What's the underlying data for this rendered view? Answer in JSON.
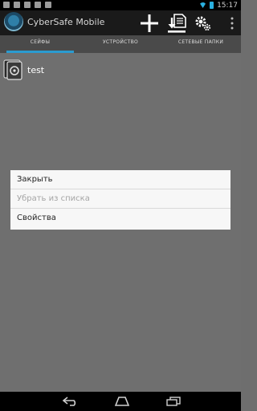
{
  "status_bar": {
    "time": "15:17"
  },
  "action_bar": {
    "title": "CyberSafe Mobile"
  },
  "tabs": [
    {
      "label": "СЕЙФЫ",
      "active": true
    },
    {
      "label": "УСТРОЙСТВО",
      "active": false
    },
    {
      "label": "СЕТЕВЫЕ ПАПКИ",
      "active": false
    }
  ],
  "list": {
    "items": [
      {
        "label": "test"
      }
    ]
  },
  "context_menu": {
    "items": [
      {
        "label": "Закрыть",
        "enabled": true
      },
      {
        "label": "Убрать из списка",
        "enabled": false
      },
      {
        "label": "Свойства",
        "enabled": true
      }
    ]
  },
  "colors": {
    "accent": "#2a9bd0",
    "dialog_bg": "#f7f7f7",
    "overlay": "#6e6e6e"
  },
  "icons": [
    "add-icon",
    "import-icon",
    "settings-icon",
    "back-icon",
    "home-icon",
    "recent-apps-icon"
  ]
}
